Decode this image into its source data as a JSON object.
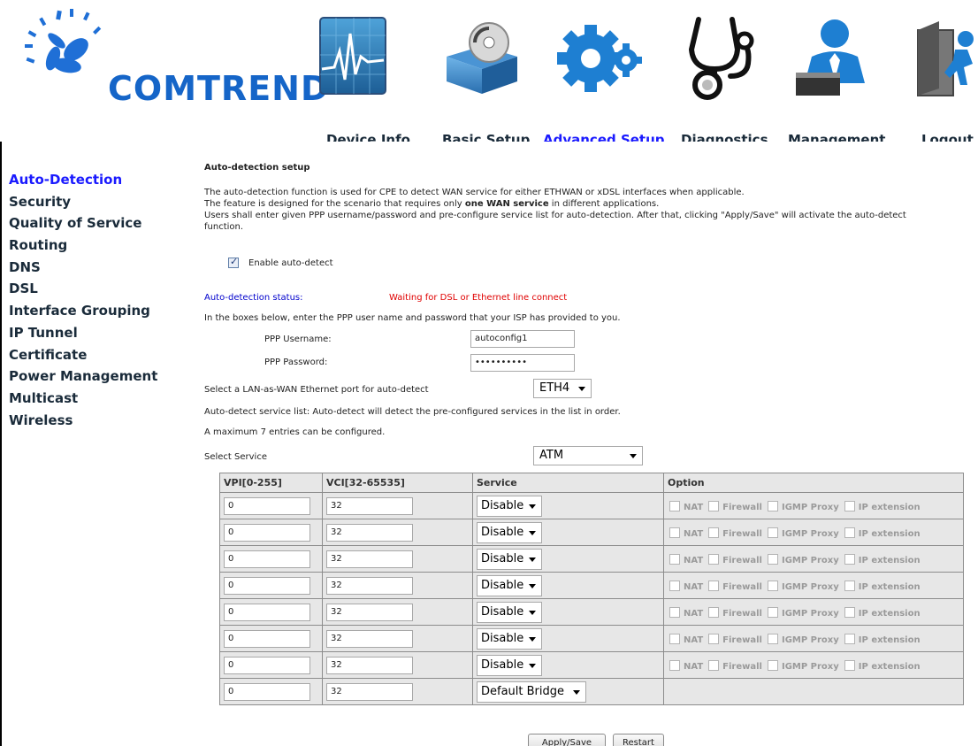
{
  "brand": {
    "name": "COMTREND"
  },
  "nav": [
    {
      "label": "Device Info",
      "icon": "heartbeat-monitor-icon"
    },
    {
      "label": "Basic Setup",
      "icon": "box-disc-icon"
    },
    {
      "label": "Advanced Setup",
      "icon": "gears-icon",
      "active": true
    },
    {
      "label": "Diagnostics",
      "icon": "stethoscope-icon"
    },
    {
      "label": "Management",
      "icon": "user-desk-icon"
    },
    {
      "label": "Logout",
      "icon": "exit-door-icon"
    }
  ],
  "sidebar": {
    "items": [
      {
        "label": "Auto-Detection",
        "active": true
      },
      {
        "label": "Security"
      },
      {
        "label": "Quality of Service"
      },
      {
        "label": "Routing"
      },
      {
        "label": "DNS"
      },
      {
        "label": "DSL"
      },
      {
        "label": "Interface Grouping"
      },
      {
        "label": "IP Tunnel"
      },
      {
        "label": "Certificate"
      },
      {
        "label": "Power Management"
      },
      {
        "label": "Multicast"
      },
      {
        "label": "Wireless"
      }
    ]
  },
  "main": {
    "title": "Auto-detection setup",
    "desc1": "The auto-detection function is used for CPE to detect WAN service for either ETHWAN or xDSL interfaces when applicable.",
    "desc2_pre": "The feature is designed for the scenario that requires only ",
    "desc2_bold": "one WAN service",
    "desc2_post": " in different applications.",
    "desc3a": "Users shall enter given PPP username/password and pre-configure service list for auto-detection. After that, clicking \"Apply/Save\" will activate the auto-detect",
    "desc3b": "function.",
    "enable_label": "Enable auto-detect",
    "status_label": "Auto-detection status:",
    "status_value": "Waiting for DSL or Ethernet line connect",
    "ppp_hint": "In the boxes below, enter the PPP user name and password that your ISP has provided to you.",
    "ppp_user_label": "PPP Username:",
    "ppp_user_value": "autoconfig1",
    "ppp_pass_label": "PPP Password:",
    "ppp_pass_value": "••••••••••",
    "lan_port_label": "Select a LAN-as-WAN Ethernet port for auto-detect",
    "lan_port_value": "ETH4",
    "service_list_note": "Auto-detect service list: Auto-detect will detect the pre-configured services in the list in order.",
    "max_entries_note": "A maximum 7 entries can be configured.",
    "select_service_label": "Select Service",
    "select_service_value": "ATM"
  },
  "table": {
    "headers": [
      "VPI[0-255]",
      "VCI[32-65535]",
      "Service",
      "Option"
    ],
    "option_labels": [
      "NAT",
      "Firewall",
      "IGMP Proxy",
      "IP extension"
    ],
    "rows": [
      {
        "vpi": "0",
        "vci": "32",
        "service": "Disable"
      },
      {
        "vpi": "0",
        "vci": "32",
        "service": "Disable"
      },
      {
        "vpi": "0",
        "vci": "32",
        "service": "Disable"
      },
      {
        "vpi": "0",
        "vci": "32",
        "service": "Disable"
      },
      {
        "vpi": "0",
        "vci": "32",
        "service": "Disable"
      },
      {
        "vpi": "0",
        "vci": "32",
        "service": "Disable"
      },
      {
        "vpi": "0",
        "vci": "32",
        "service": "Disable"
      },
      {
        "vpi": "0",
        "vci": "32",
        "service": "Default Bridge"
      }
    ]
  },
  "buttons": {
    "apply": "Apply/Save",
    "restart": "Restart"
  },
  "colors": {
    "active_link": "#1a1aff",
    "status_red": "#e00000",
    "status_label_blue": "#0000cc",
    "brand_blue": "#1565c8",
    "table_bg": "#e7e7e7"
  }
}
